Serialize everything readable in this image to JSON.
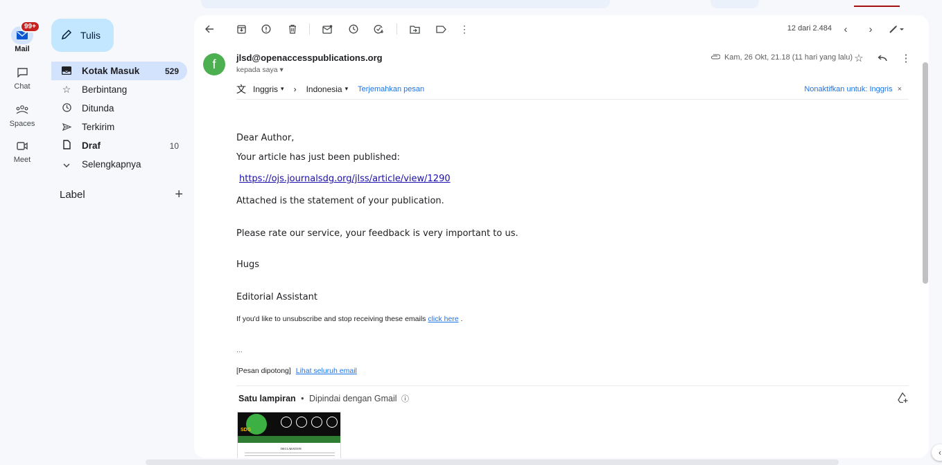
{
  "rail": {
    "mail": {
      "label": "Mail",
      "badge": "99+"
    },
    "chat": {
      "label": "Chat"
    },
    "spaces": {
      "label": "Spaces"
    },
    "meet": {
      "label": "Meet"
    }
  },
  "compose": {
    "label": "Tulis"
  },
  "nav": {
    "items": [
      {
        "label": "Kotak Masuk",
        "count": "529",
        "icon": "inbox-icon"
      },
      {
        "label": "Berbintang",
        "count": "",
        "icon": "star-icon"
      },
      {
        "label": "Ditunda",
        "count": "",
        "icon": "clock-icon"
      },
      {
        "label": "Terkirim",
        "count": "",
        "icon": "send-icon"
      },
      {
        "label": "Draf",
        "count": "10",
        "icon": "draft-icon"
      },
      {
        "label": "Selengkapnya",
        "count": "",
        "icon": "chevron-down-icon"
      }
    ],
    "label_heading": "Label"
  },
  "toolbar": {
    "pager": "12 dari 2.484"
  },
  "email": {
    "avatar_letter": "f",
    "sender": "jlsd@openaccesspublications.org",
    "to": "kepada saya",
    "date": "Kam, 26 Okt, 21.18 (11 hari yang lalu)",
    "translate": {
      "from": "Inggris",
      "to": "Indonesia",
      "action": "Terjemahkan pesan",
      "disable": "Nonaktifkan untuk: Inggris"
    },
    "body": {
      "greeting": "Dear Author,",
      "line1": "Your article has just been published:",
      "link": "https://ojs.journalsdg.org/jlss/article/view/1290",
      "line2": "Attached is the statement of your publication.",
      "line3": "Please rate our service, your feedback is very important to us.",
      "line4": "Hugs",
      "line5": "Editorial Assistant",
      "unsub_text": "If you'd like to unsubscribe and stop receiving these emails",
      "unsub_link": "click here",
      "unsub_end": ".",
      "ellipsis": "...",
      "clipped": "[Pesan dipotong]",
      "view_all": "Lihat seluruh email"
    },
    "attachment": {
      "title": "Satu lampiran",
      "separator": "•",
      "scanned": "Dipindai dengan Gmail",
      "thumb_tag": "SDG",
      "thumb_doc_title": "DECLARATION"
    }
  },
  "colors": {
    "accent": "#1a73e8",
    "selected_nav": "#d3e3fd",
    "compose_bg": "#c2e7ff",
    "badge": "#c5221f",
    "avatar": "#4caf50"
  }
}
